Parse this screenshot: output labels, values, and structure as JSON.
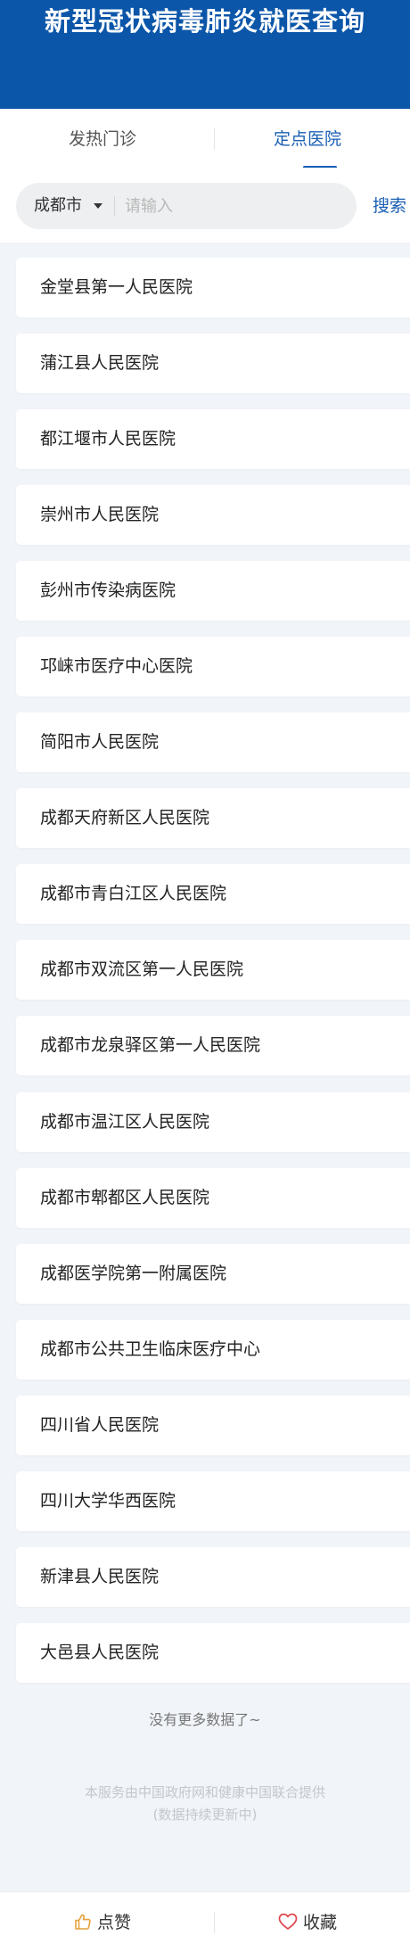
{
  "header": {
    "title": "新型冠状病毒肺炎就医查询"
  },
  "tabs": [
    {
      "label": "发热门诊",
      "active": false
    },
    {
      "label": "定点医院",
      "active": true
    }
  ],
  "search": {
    "city": "成都市",
    "placeholder": "请输入",
    "value": "",
    "button_label": "搜索"
  },
  "hospitals": [
    "金堂县第一人民医院",
    "蒲江县人民医院",
    "都江堰市人民医院",
    "崇州市人民医院",
    "彭州市传染病医院",
    "邛崃市医疗中心医院",
    "简阳市人民医院",
    "成都天府新区人民医院",
    "成都市青白江区人民医院",
    "成都市双流区第一人民医院",
    "成都市龙泉驿区第一人民医院",
    "成都市温江区人民医院",
    "成都市郫都区人民医院",
    "成都医学院第一附属医院",
    "成都市公共卫生临床医疗中心",
    "四川省人民医院",
    "四川大学华西医院",
    "新津县人民医院",
    "大邑县人民医院"
  ],
  "list_end_text": "没有更多数据了~",
  "footer": {
    "line1": "本服务由中国政府网和健康中国联合提供",
    "line2": "(数据持续更新中)"
  },
  "bottom_bar": {
    "like_label": "点赞",
    "favorite_label": "收藏"
  },
  "colors": {
    "header_bg": "#0b56a9",
    "accent": "#1a5fb4",
    "favorite_icon": "#e0434b",
    "like_icon": "#e6a23c"
  },
  "icons": {
    "like": "thumbs-up-icon",
    "favorite": "heart-icon",
    "city_dropdown": "caret-down-icon"
  }
}
